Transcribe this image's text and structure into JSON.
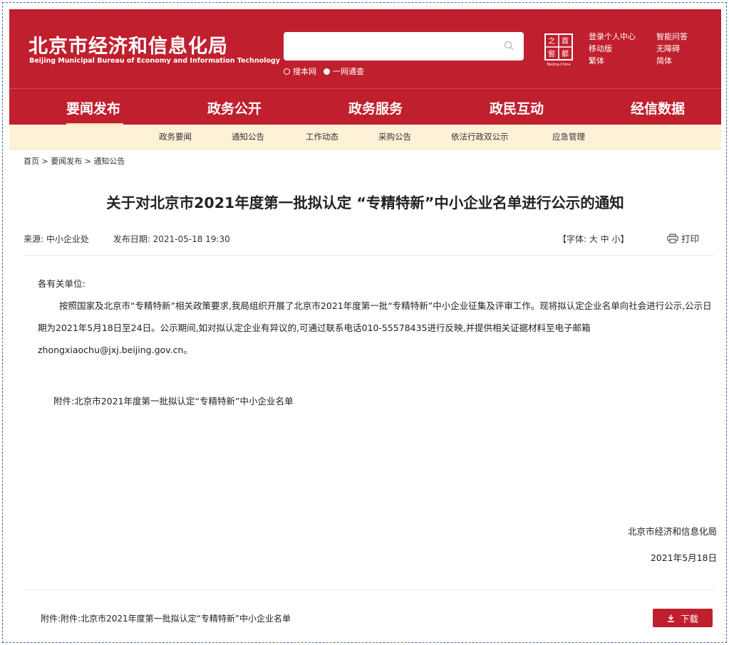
{
  "header": {
    "logo_cn": "北京市经济和信息化局",
    "logo_en": "Beijing Municipal Bureau of Economy and Information Technology",
    "search_options": [
      "搜本网",
      "一网通查"
    ],
    "seal_text": "首都之窗",
    "seal_sub": "Beijing-China",
    "links_col1": [
      "登录个人中心",
      "移动版",
      "繁体"
    ],
    "links_col2": [
      "智能问答",
      "无障碍",
      "简体"
    ]
  },
  "main_nav": [
    "要闻发布",
    "政务公开",
    "政务服务",
    "政民互动",
    "经信数据"
  ],
  "sub_nav": [
    "政务要闻",
    "通知公告",
    "工作动态",
    "采购公告",
    "依法行政双公示",
    "应急管理"
  ],
  "breadcrumb": "首页 > 要闻发布 > 通知公告",
  "article": {
    "title": "关于对北京市2021年度第一批拟认定 “专精特新”中小企业名单进行公示的通知",
    "source_label": "来源:",
    "source": "中小企业处",
    "date_label": "发布日期:",
    "date": "2021-05-18 19:30",
    "font_size_control": "【字体: 大 中 小】",
    "print_label": "打印",
    "greeting": "各有关单位:",
    "paragraph": "按照国家及北京市“专精特新”相关政策要求,我局组织开展了北京市2021年度第一批“专精特新”中小企业征集及评审工作。现将拟认定企业名单向社会进行公示,公示日期为2021年5月18日至24日。公示期间,如对拟认定企业有异议的,可通过联系电话010-55578435进行反映,并提供相关证据材料至电子邮箱zhongxiaochu@jxj.beijing.gov.cn。",
    "attachment_inline": "附件:北京市2021年度第一批拟认定“专精特新”中小企业名单",
    "signature": "北京市经济和信息化局",
    "sign_date": "2021年5月18日",
    "attachment_bottom": "附件:附件:北京市2021年度第一批拟认定“专精特新”中小企业名单",
    "download_label": "下载"
  },
  "colors": {
    "brand_red": "#c01f2e",
    "subnav_bg": "#fdf1d7"
  }
}
